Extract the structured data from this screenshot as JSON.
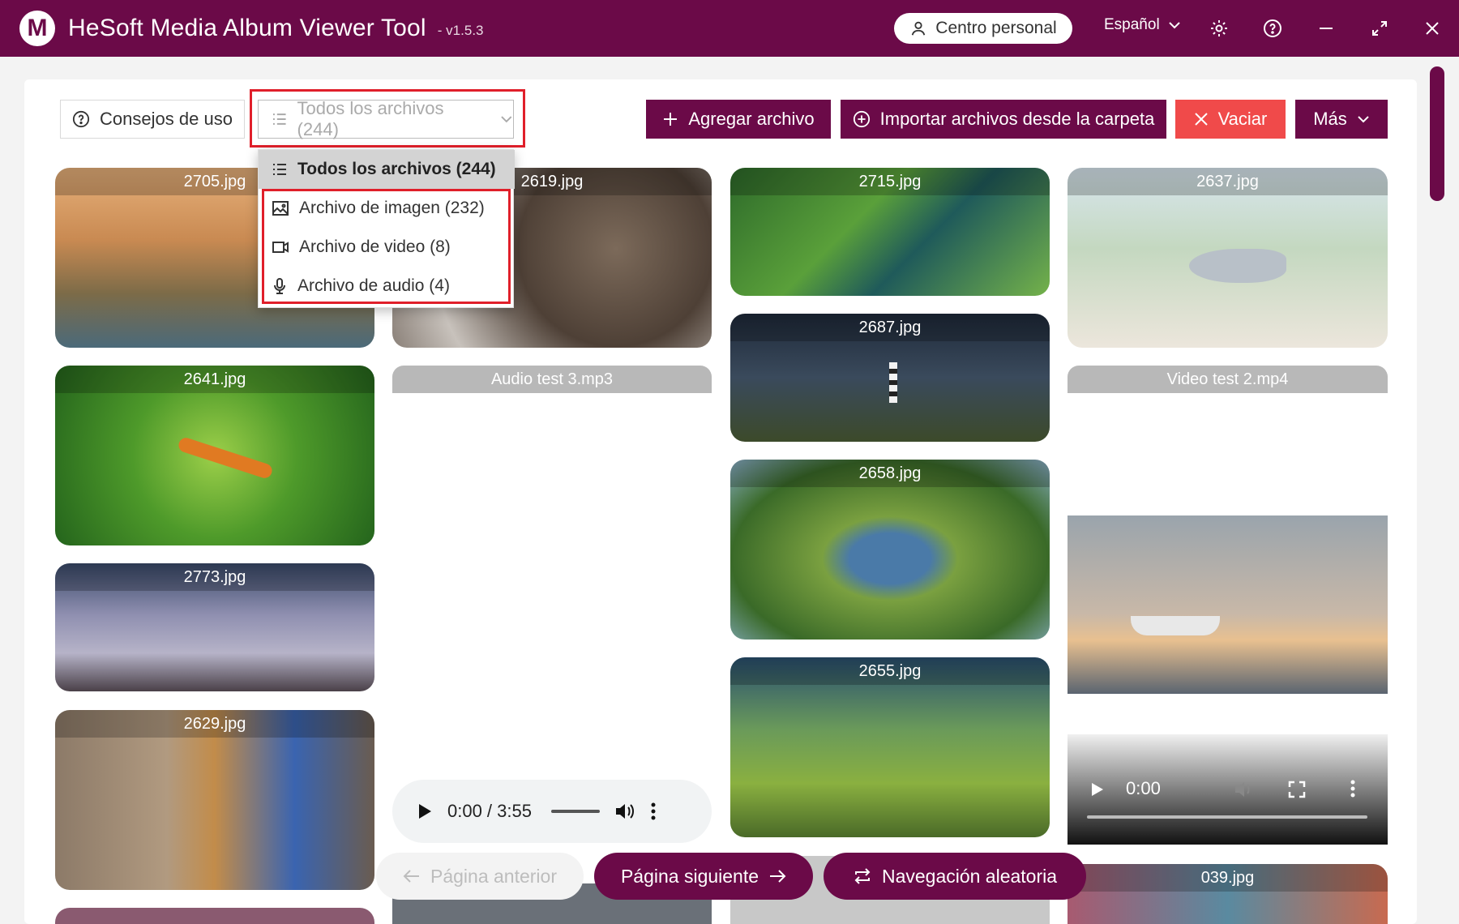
{
  "app": {
    "logo_letter": "M",
    "title": "HeSoft Media Album Viewer Tool",
    "version": "- v1.5.3"
  },
  "titlebar": {
    "personal_label": "Centro personal",
    "language": "Español"
  },
  "toolbar": {
    "tips_label": "Consejos de uso",
    "filter_value": "Todos los archivos (244)",
    "add_label": "Agregar archivo",
    "import_label": "Importar archivos desde la carpeta",
    "clear_label": "Vaciar",
    "more_label": "Más"
  },
  "dropdown": {
    "options": [
      {
        "label": "Todos los archivos (244)",
        "icon": "list-icon",
        "selected": true
      },
      {
        "label": "Archivo de imagen (232)",
        "icon": "image-icon"
      },
      {
        "label": "Archivo de video (8)",
        "icon": "video-icon"
      },
      {
        "label": "Archivo de audio (4)",
        "icon": "microphone-icon"
      }
    ]
  },
  "gallery": {
    "col1": [
      "2705.jpg",
      "2641.jpg",
      "2773.jpg",
      "2629.jpg"
    ],
    "col2": [
      "2619.jpg",
      "Audio test 3.mp3"
    ],
    "col3": [
      "2715.jpg",
      "2687.jpg",
      "2658.jpg",
      "2655.jpg"
    ],
    "col4": [
      "2637.jpg",
      "Video test 2.mp4",
      "039.jpg"
    ]
  },
  "audio_player": {
    "time": "0:00 / 3:55"
  },
  "video_player": {
    "time": "0:00"
  },
  "pagination": {
    "prev_label": "Página anterior",
    "next_label": "Página siguiente",
    "random_label": "Navegación aleatoria"
  },
  "colors": {
    "brand": "#6b0a48",
    "danger": "#f04a4a",
    "highlight": "#e01f2a"
  }
}
